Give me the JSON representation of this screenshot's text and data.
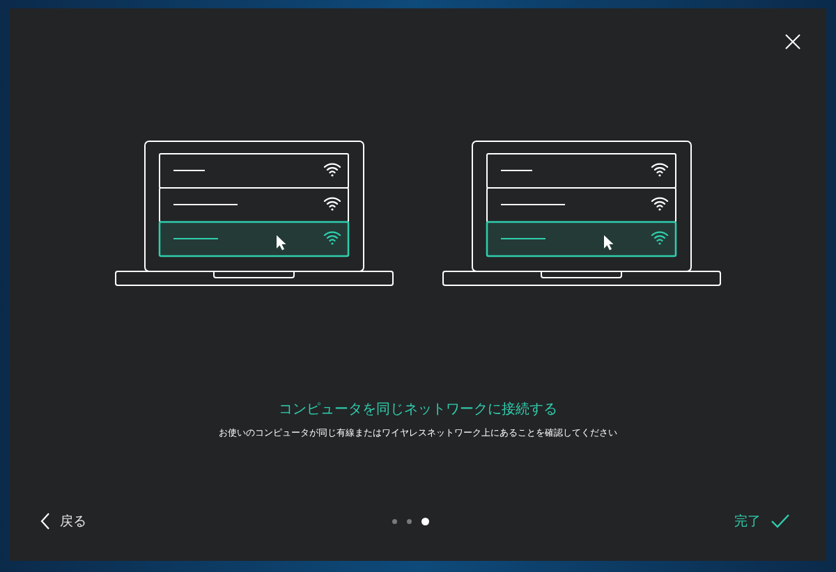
{
  "dialog": {
    "illustrations": [
      {
        "rows": [
          {
            "selected": false
          },
          {
            "selected": false
          },
          {
            "selected": true
          }
        ]
      },
      {
        "rows": [
          {
            "selected": false
          },
          {
            "selected": false
          },
          {
            "selected": true
          }
        ]
      }
    ],
    "title": "コンピュータを同じネットワークに接続する",
    "description": "お使いのコンピュータが同じ有線またはワイヤレスネットワーク上にあることを確認してください",
    "back_button": {
      "label": "戻る"
    },
    "pages": [
      {
        "selected": false
      },
      {
        "selected": false
      },
      {
        "selected": true
      }
    ],
    "finish_button": {
      "label": "完了"
    }
  }
}
